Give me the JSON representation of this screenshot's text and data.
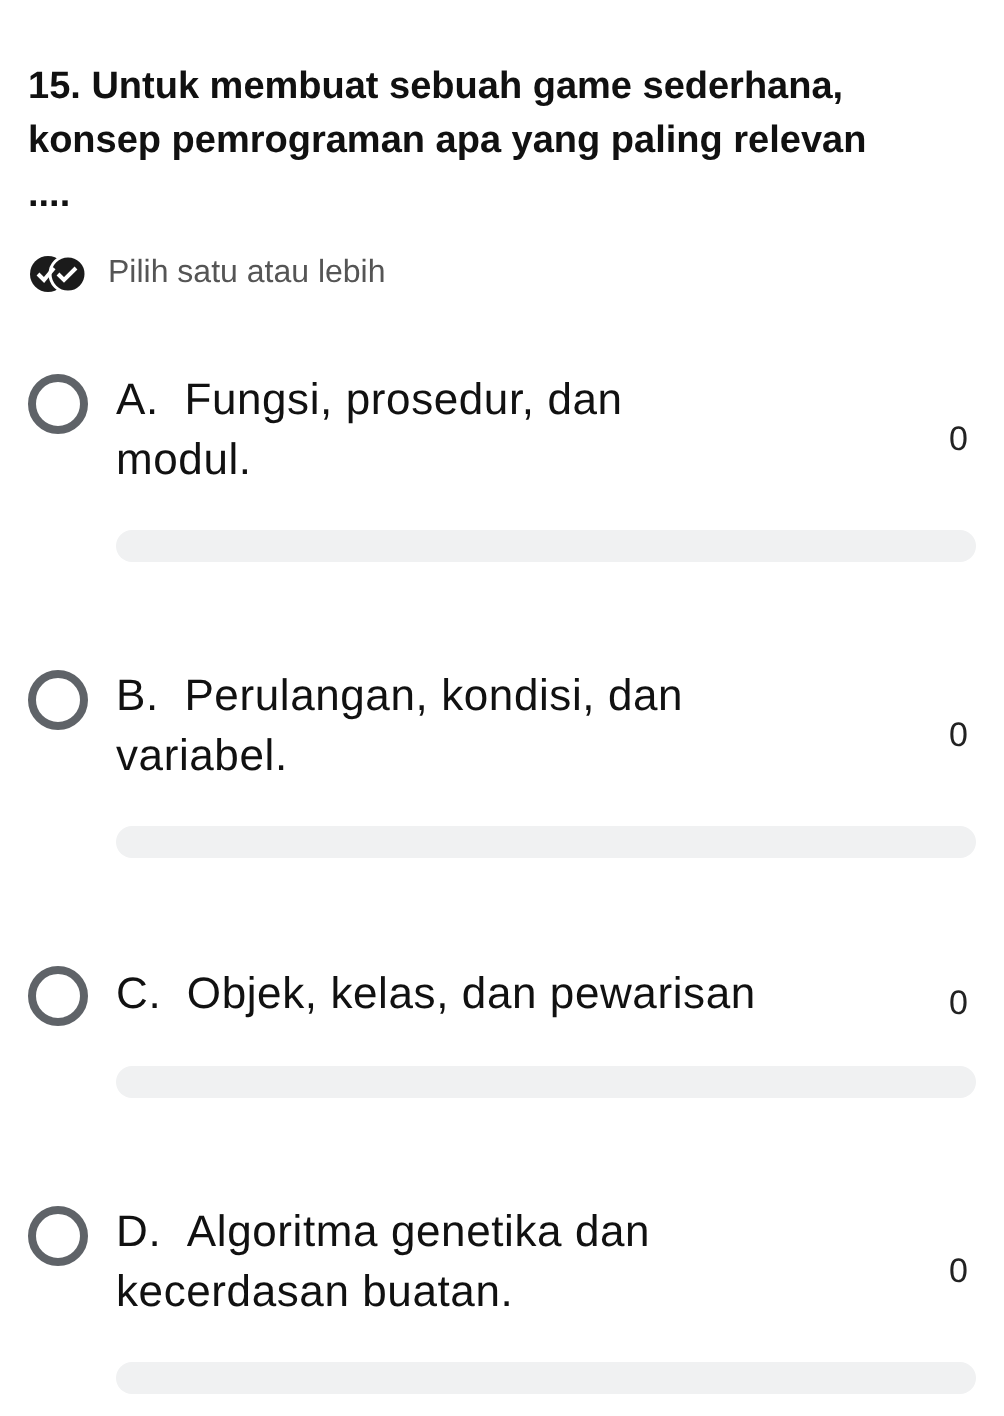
{
  "question": {
    "number": "15.",
    "text": "Untuk membuat sebuah game sederhana, konsep pemrograman apa yang paling relevan ...."
  },
  "hint": "Pilih satu atau lebih",
  "options": [
    {
      "letter": "A.",
      "text": "Fungsi, prosedur, dan modul.",
      "count": "0",
      "selected": false,
      "level": 0
    },
    {
      "letter": "B.",
      "text": "Perulangan, kondisi, dan variabel.",
      "count": "0",
      "selected": false,
      "level": 0
    },
    {
      "letter": "C.",
      "text": "Objek, kelas, dan pewarisan",
      "count": "0",
      "selected": false,
      "level": 0
    },
    {
      "letter": "D.",
      "text": "Algoritma genetika dan kecerdasan buatan.",
      "count": "0",
      "selected": false,
      "level": 0
    }
  ]
}
